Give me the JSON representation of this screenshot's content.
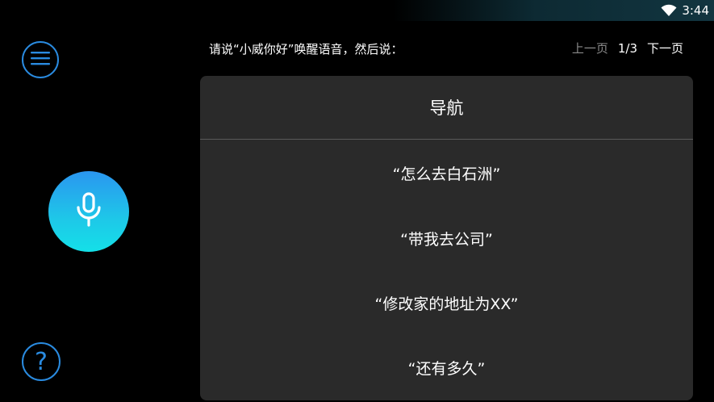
{
  "status_bar": {
    "time": "3:44",
    "wifi_icon": "wifi-icon"
  },
  "sidebar": {
    "menu_icon": "hamburger-menu-icon",
    "mic_icon": "microphone-icon",
    "help_icon": "question-mark-icon",
    "help_glyph": "?",
    "accent_color": "#2a8be0"
  },
  "header": {
    "hint": "请说“小威你好”唤醒语音，然后说：",
    "prev_label": "上一页",
    "page_indicator": "1/3",
    "next_label": "下一页"
  },
  "card": {
    "title": "导航",
    "commands": [
      "“怎么去白石洲”",
      "“带我去公司”",
      "“修改家的地址为XX”",
      "“还有多久”"
    ]
  }
}
